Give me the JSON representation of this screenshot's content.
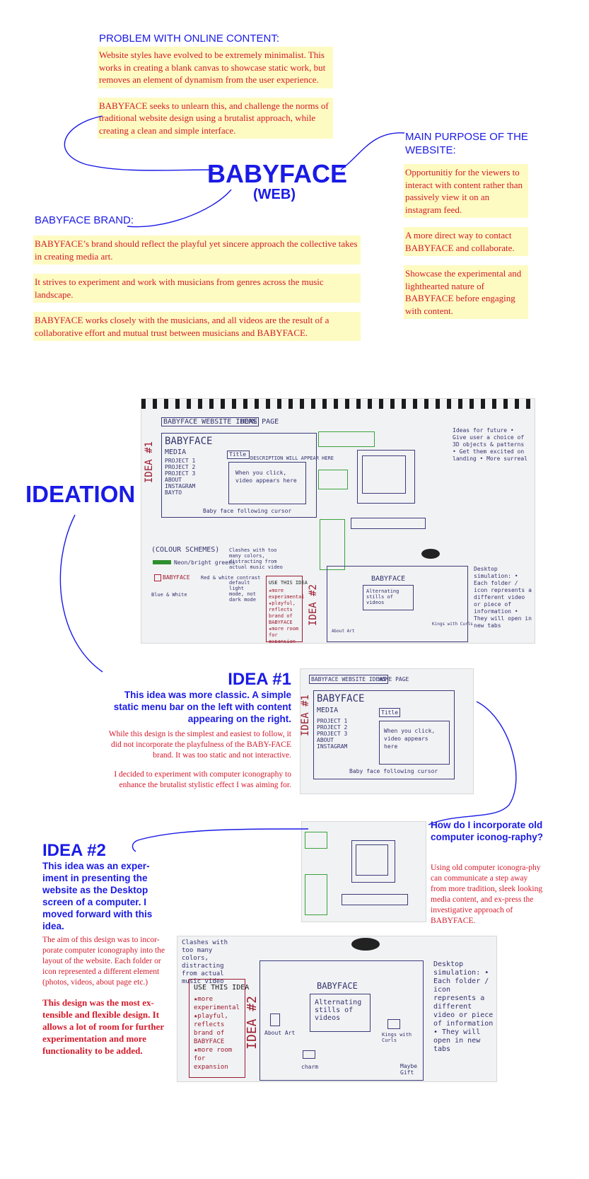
{
  "problem": {
    "heading": "PROBLEM WITH ONLINE CONTENT:",
    "para1": "Website styles have evolved to be extremely minimalist. This works in creating a blank canvas to showcase static work, but removes an element of dynamism from the user experience.",
    "para2": "BABYFACE seeks to unlearn this, and challenge the norms of traditional website design using a brutalist approach, while creating a clean and simple interface."
  },
  "title": {
    "main": "BABYFACE",
    "sub": "(WEB)"
  },
  "purpose": {
    "heading": "MAIN PURPOSE OF THE WEBSITE:",
    "items": [
      "Opportunitiy for the viewers to interact with content rather than passively view it on an instagram feed.",
      "A more direct way to contact BABYFACE and collaborate.",
      "Showcase the experimental and lighthearted nature of BABYFACE before engaging with content."
    ]
  },
  "brand": {
    "heading": "BABYFACE BRAND:",
    "items": [
      "BABYFACE’s brand should reflect the playful yet sincere approach the collective takes in creating media art.",
      "It strives to experiment and work with musicians from genres across the music landscape.",
      "BABYFACE works closely with the musicians, and all videos are the result of a collaborative effort and mutual trust between musicians and BABYFACE."
    ]
  },
  "ideation": {
    "heading": "IDEATION"
  },
  "sketch": {
    "page_title": "BABYFACE WEBSITE IDEAS",
    "home_page": "HOME PAGE",
    "logo": "BABYFACE",
    "media": "MEDIA",
    "menu": [
      "PROJECT 1",
      "PROJECT 2",
      "PROJECT 3",
      "ABOUT",
      "INSTAGRAM",
      "BAYTO"
    ],
    "idea1_vertical": "IDEA #1",
    "idea2_vertical": "IDEA #2",
    "title_box": "Title",
    "description": "DESCRIPTION WILL APPEAR HERE",
    "video_note": "When you click, video appears here",
    "cursor_note": "Baby face following cursor",
    "colour_schemes": "(COLOUR SCHEMES)",
    "neon": "Neon/bright greens",
    "babyface_red": "BABYFACE",
    "red_white": "Red & white contrast",
    "blue_white": "Blue & White",
    "clashes": "Clashes with too many colors, distracting from actual music video",
    "default": "default light mode, not dark mode",
    "use_this": "USE THIS IDEA",
    "use_list": "★more experimental ★playful, reflects brand of BABYFACE ★more room for expansion",
    "screen_title": "BABYFACE",
    "screen_text": "Alternating stills of videos",
    "about": "About Art",
    "charm": "charm",
    "kings": "Kings with Curls",
    "maybe": "Maybe Gift",
    "desktop_notes": "Desktop simulation: • Each folder / icon represents a different video or piece of information • They will open in new tabs",
    "right_notes": "Ideas for future • Give user a choice of 3D objects & patterns • Get them excited on landing • More surreal"
  },
  "idea1": {
    "heading": "IDEA #1",
    "summary": "This idea was more classic. A simple static menu bar on the left with content appearing on the right.",
    "para1": "While this design is the simplest and easiest to follow, it did not incorporate the playfulness of the BABY-FACE brand. It was too static and not interactive.",
    "para2": "I decided to experiment with computer iconography to enhance the brutalist stylistic effect I was aiming for."
  },
  "question": {
    "heading": "How do I incorporate old computer iconog-raphy?",
    "para": "Using old computer iconogra-phy can communicate a step away from more tradition, sleek looking media content, and ex-press the investigative approach of BABYFACE."
  },
  "idea2": {
    "heading": "IDEA #2",
    "summary": "This idea was an exper-iment in presenting the website as the Desktop screen of a computer. I moved forward with this idea.",
    "para1": "The aim of this design was to incor-porate computer iconography into the layout of the website. Each folder or icon represented a different element (photos, videos, about page etc.)",
    "para2": "This design was the most ex-tensible and flexible design. It allows a lot of room for further experimentation and more functionality to be added."
  },
  "colors": {
    "blue": "#1a1ae6",
    "red": "#d41a2a",
    "highlight": "#fdfbc2"
  }
}
